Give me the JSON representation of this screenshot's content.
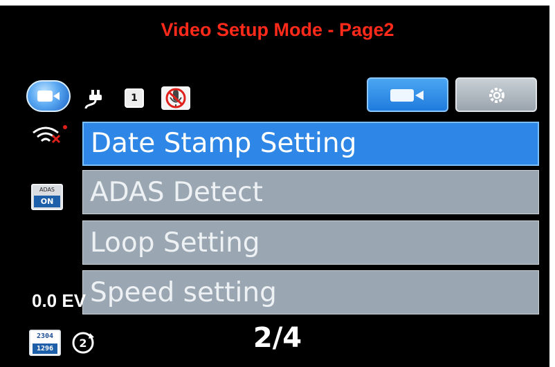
{
  "header": {
    "title": "Video Setup Mode - Page2"
  },
  "status_bar": {
    "icons": [
      "video-mode-icon",
      "power-plug-icon",
      "sd-card-icon",
      "mic-muted-icon"
    ],
    "card_label": "1"
  },
  "tabs": [
    {
      "name": "video",
      "icon": "video-camera-icon",
      "active": true
    },
    {
      "name": "setup",
      "icon": "gear-icon",
      "active": false
    }
  ],
  "left_indicators": {
    "wifi": "wifi-off-icon",
    "adas_top": "ADAS",
    "adas_bottom": "ON",
    "ev": "0.0 EV",
    "res_top": "2304",
    "res_bottom": "1296",
    "loop": "2"
  },
  "menu": {
    "items": [
      {
        "label": "Date Stamp Setting",
        "selected": true
      },
      {
        "label": "ADAS Detect",
        "selected": false
      },
      {
        "label": "Loop Setting",
        "selected": false
      },
      {
        "label": "Speed setting",
        "selected": false
      }
    ]
  },
  "footer": {
    "page": "2/4"
  },
  "colors": {
    "title": "#ff2a1a",
    "selected": "#2e86e6",
    "item": "#9aa7b2",
    "background": "#000000"
  }
}
